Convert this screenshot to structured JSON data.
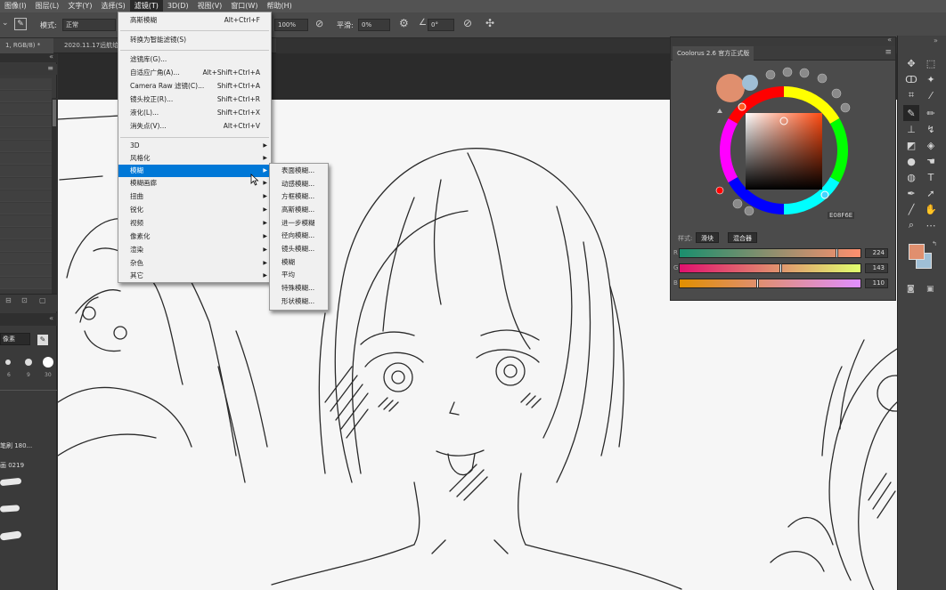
{
  "menubar": {
    "items": [
      {
        "label": "图像(I)"
      },
      {
        "label": "图层(L)"
      },
      {
        "label": "文字(Y)"
      },
      {
        "label": "选择(S)"
      },
      {
        "label": "滤镜(T)",
        "active": true
      },
      {
        "label": "3D(D)"
      },
      {
        "label": "视图(V)"
      },
      {
        "label": "窗口(W)"
      },
      {
        "label": "帮助(H)"
      }
    ]
  },
  "options": {
    "mode_label": "模式:",
    "mode_value": "正常",
    "opacity_value": "100%",
    "smooth_label": "平滑:",
    "smooth_value": "0%",
    "angle_value": "0°"
  },
  "tabs": [
    {
      "label": "1, RGB/8) *"
    },
    {
      "label": "2020.11.17远航给"
    }
  ],
  "filter_menu": {
    "items": [
      {
        "label": "高斯模糊",
        "shortcut": "Alt+Ctrl+F"
      },
      {
        "label": "转换为智能滤镜(S)"
      },
      {
        "label": "滤镜库(G)..."
      },
      {
        "label": "自适应广角(A)...",
        "shortcut": "Alt+Shift+Ctrl+A"
      },
      {
        "label": "Camera Raw 滤镜(C)...",
        "shortcut": "Shift+Ctrl+A"
      },
      {
        "label": "镜头校正(R)...",
        "shortcut": "Shift+Ctrl+R"
      },
      {
        "label": "液化(L)...",
        "shortcut": "Shift+Ctrl+X"
      },
      {
        "label": "消失点(V)...",
        "shortcut": "Alt+Ctrl+V"
      },
      {
        "label": "3D",
        "submenu": true
      },
      {
        "label": "风格化",
        "submenu": true
      },
      {
        "label": "模糊",
        "submenu": true,
        "highlighted": true
      },
      {
        "label": "模糊画廊",
        "submenu": true
      },
      {
        "label": "扭曲",
        "submenu": true
      },
      {
        "label": "锐化",
        "submenu": true
      },
      {
        "label": "视频",
        "submenu": true
      },
      {
        "label": "像素化",
        "submenu": true
      },
      {
        "label": "渲染",
        "submenu": true
      },
      {
        "label": "杂色",
        "submenu": true
      },
      {
        "label": "其它",
        "submenu": true
      }
    ]
  },
  "blur_submenu": {
    "items": [
      {
        "label": "表面模糊..."
      },
      {
        "label": "动感模糊..."
      },
      {
        "label": "方框模糊..."
      },
      {
        "label": "高斯模糊..."
      },
      {
        "label": "进一步模糊"
      },
      {
        "label": "径向模糊..."
      },
      {
        "label": "镜头模糊..."
      },
      {
        "label": "模糊"
      },
      {
        "label": "平均"
      },
      {
        "label": "特殊模糊..."
      },
      {
        "label": "形状模糊..."
      }
    ]
  },
  "left_panel": {
    "unit_label": "像素",
    "brush_sizes": [
      "6",
      "9",
      "30"
    ],
    "brush_info_1": "笔刷 180...",
    "brush_info_2": "画 0219"
  },
  "coolorus": {
    "title": "Coolorus 2.6 官方正式版",
    "hex": "E08F6E",
    "mode_label": "样式:",
    "btn_block": "滑块",
    "btn_mixer": "混合器",
    "sliders": [
      {
        "channel": "R",
        "value": "224",
        "fraction": 0.878
      },
      {
        "channel": "G",
        "value": "143",
        "fraction": 0.561
      },
      {
        "channel": "B",
        "value": "110",
        "fraction": 0.431
      }
    ]
  },
  "colors": {
    "foreground": "#E08F6E",
    "background": "#9fbfd6",
    "menu_highlight": "#0078d7"
  },
  "tools": [
    {
      "icon": "move-icon"
    },
    {
      "icon": "marquee-icon"
    },
    {
      "icon": "lasso-icon"
    },
    {
      "icon": "magic-wand-icon"
    },
    {
      "icon": "crop-icon"
    },
    {
      "icon": "eyedropper-icon"
    },
    {
      "icon": "brush-icon"
    },
    {
      "icon": "pencil-icon"
    },
    {
      "icon": "stamp-icon"
    },
    {
      "icon": "history-brush-icon"
    },
    {
      "icon": "eraser-icon"
    },
    {
      "icon": "bucket-icon"
    },
    {
      "icon": "blur-icon"
    },
    {
      "icon": "smudge-icon"
    },
    {
      "icon": "sponge-icon"
    },
    {
      "icon": "type-icon"
    },
    {
      "icon": "pen-icon"
    },
    {
      "icon": "select-arrow-icon"
    },
    {
      "icon": "line-icon"
    },
    {
      "icon": "hand-icon"
    },
    {
      "icon": "zoom-icon"
    },
    {
      "icon": "more-icon"
    }
  ]
}
